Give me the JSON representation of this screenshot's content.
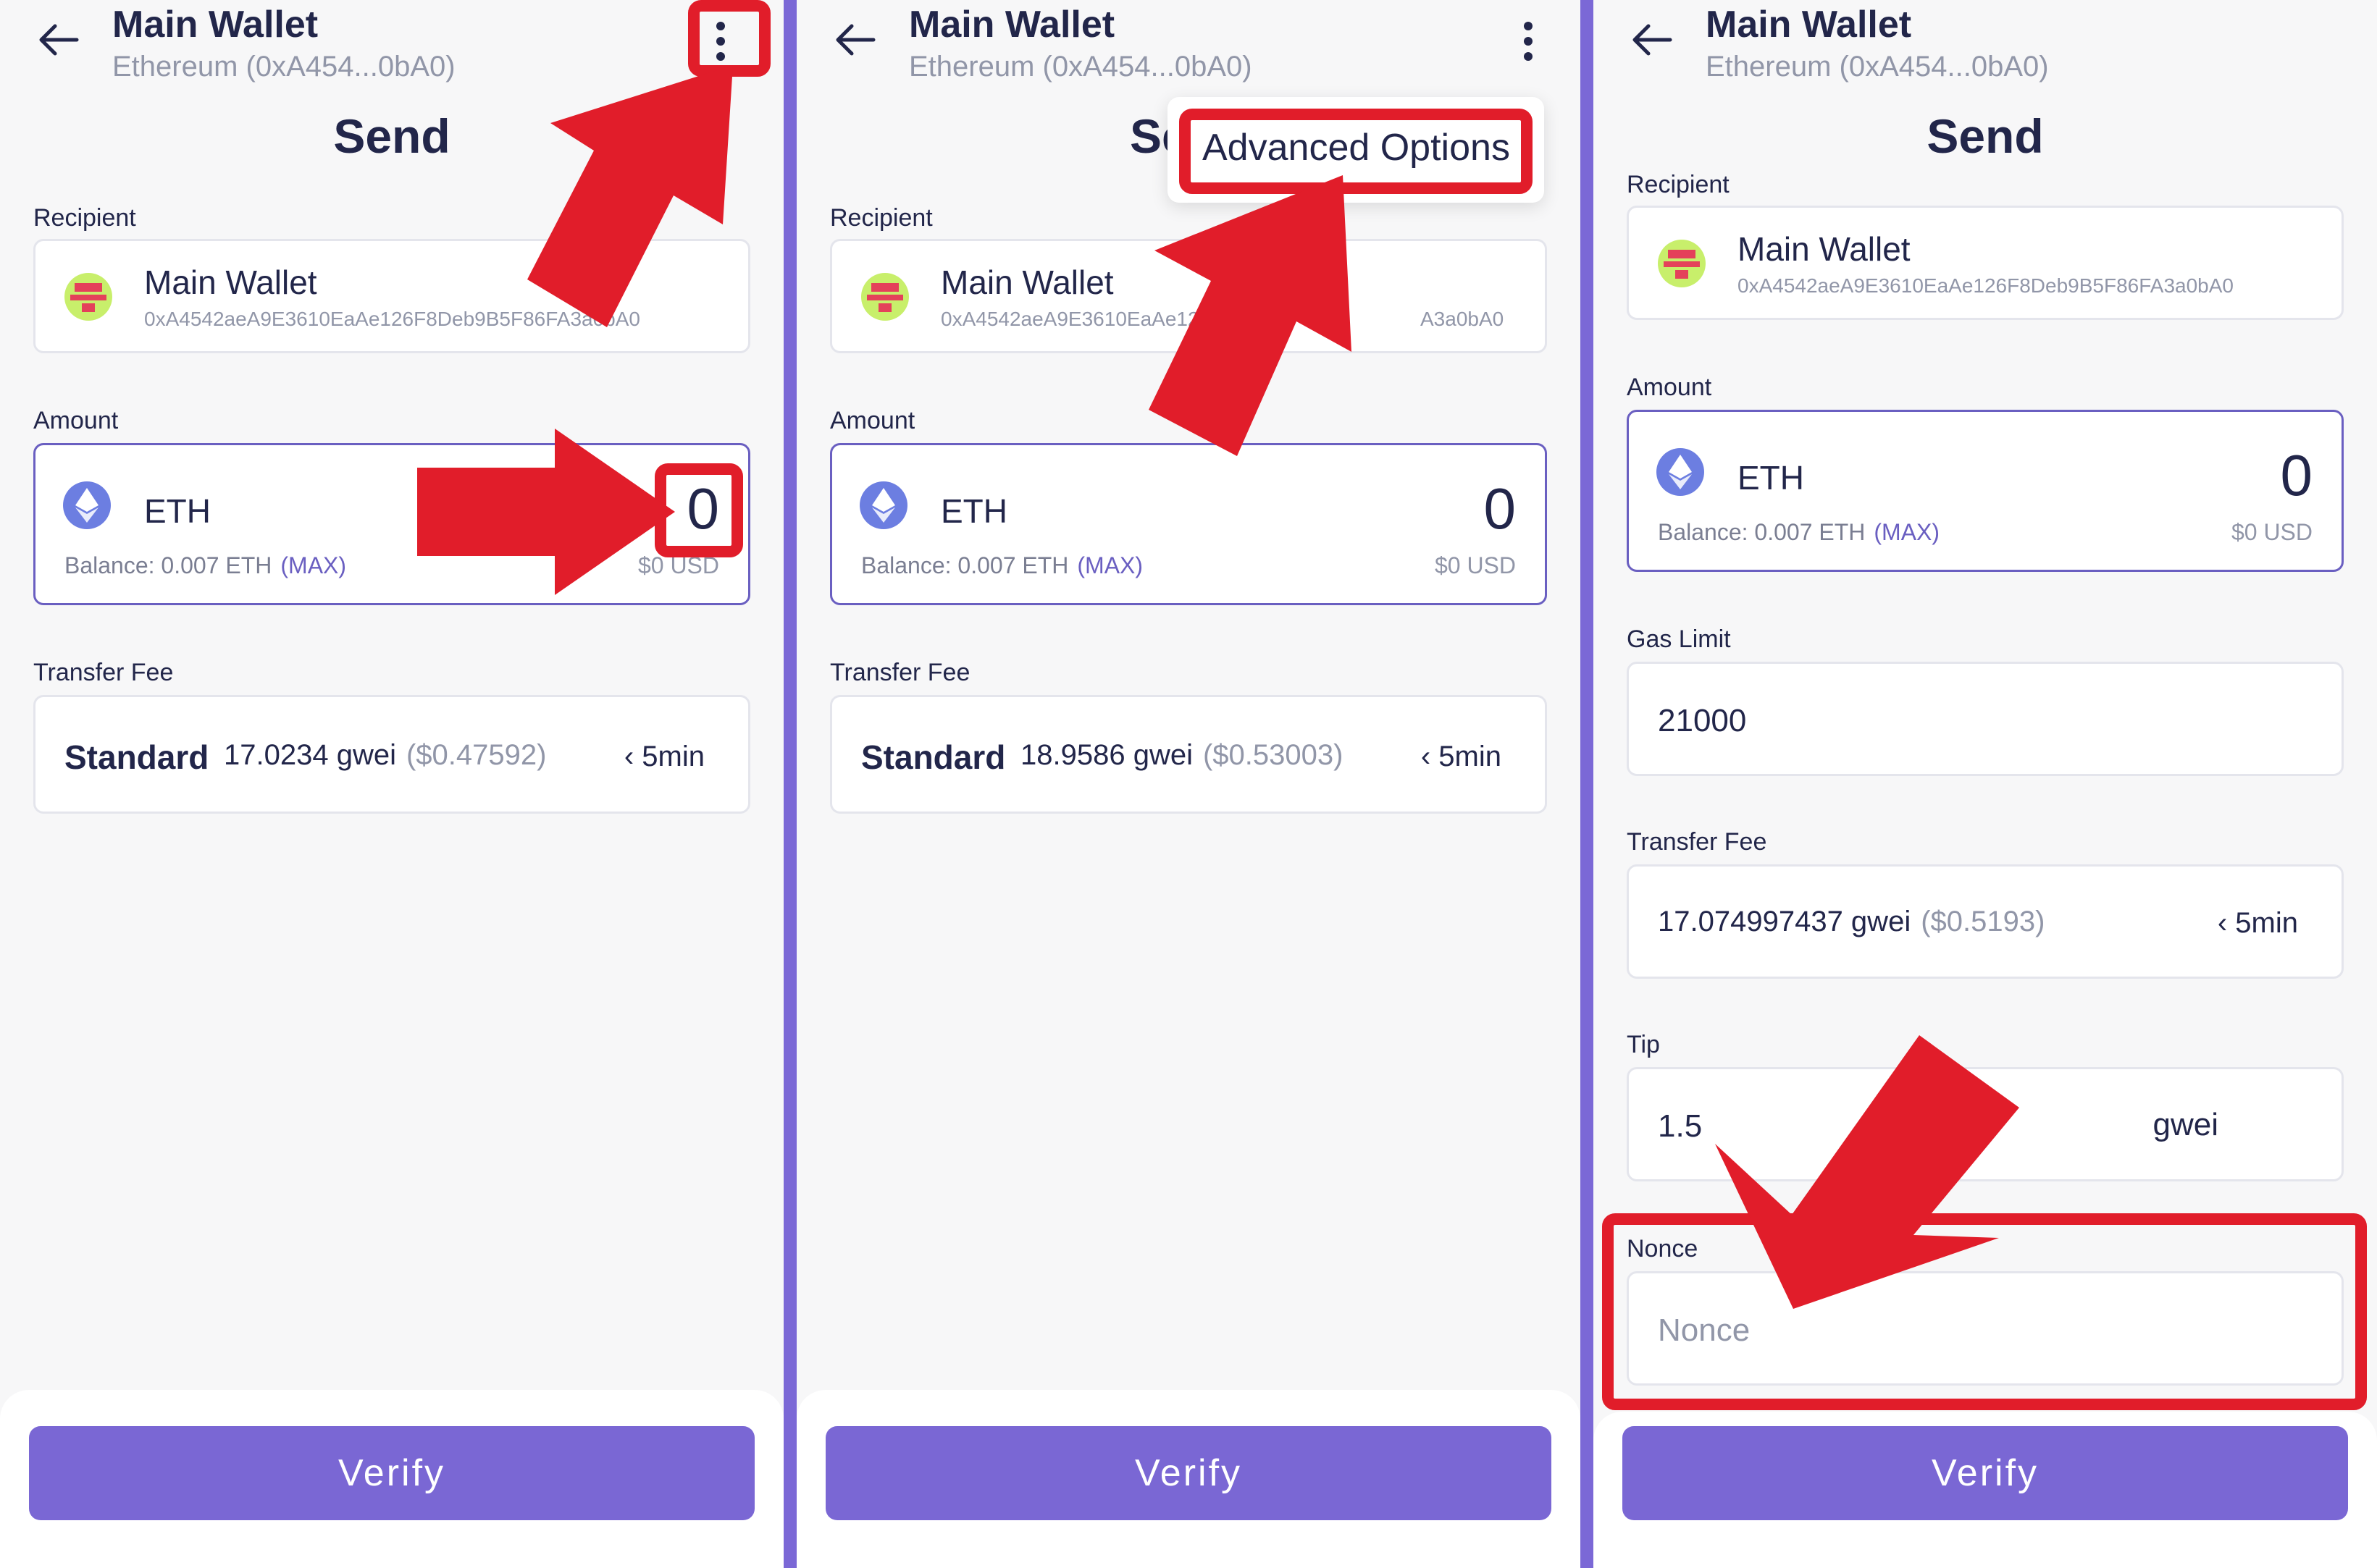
{
  "panels": [
    {
      "wallet_title": "Main Wallet",
      "wallet_sub": "Ethereum (0xA454...0bA0)",
      "page_title": "Send",
      "recipient_label": "Recipient",
      "recipient_name": "Main Wallet",
      "recipient_addr": "0xA4542aeA9E3610EaAe126F8Deb9B5F86FA3a0bA0",
      "amount_label": "Amount",
      "token": "ETH",
      "amount": "0",
      "balance_label": "Balance:",
      "balance_value": "0.007 ETH",
      "max": "(MAX)",
      "usd": "$0 USD",
      "fee_label": "Transfer Fee",
      "fee_tier": "Standard",
      "fee_gwei": "17.0234 gwei",
      "fee_usd": "($0.47592)",
      "fee_time": "‹ 5min",
      "verify": "Verify"
    },
    {
      "wallet_title": "Main Wallet",
      "wallet_sub": "Ethereum (0xA454...0bA0)",
      "page_title": "Se",
      "menu_item": "Advanced Options",
      "recipient_label": "Recipient",
      "recipient_name": "Main Wallet",
      "recipient_addr": "0xA4542aeA9E3610EaAe12",
      "recipient_addr_tail": "A3a0bA0",
      "amount_label": "Amount",
      "token": "ETH",
      "amount": "0",
      "balance_label": "Balance:",
      "balance_value": "0.007 ETH",
      "max": "(MAX)",
      "usd": "$0 USD",
      "fee_label": "Transfer Fee",
      "fee_tier": "Standard",
      "fee_gwei": "18.9586 gwei",
      "fee_usd": "($0.53003)",
      "fee_time": "‹ 5min",
      "verify": "Verify"
    },
    {
      "wallet_title": "Main Wallet",
      "wallet_sub": "Ethereum (0xA454...0bA0)",
      "page_title": "Send",
      "recipient_label": "Recipient",
      "recipient_name": "Main Wallet",
      "recipient_addr": "0xA4542aeA9E3610EaAe126F8Deb9B5F86FA3a0bA0",
      "amount_label": "Amount",
      "token": "ETH",
      "amount": "0",
      "balance_label": "Balance:",
      "balance_value": "0.007 ETH",
      "max": "(MAX)",
      "usd": "$0 USD",
      "gas_limit_label": "Gas Limit",
      "gas_limit_value": "21000",
      "fee_label": "Transfer Fee",
      "fee_gwei": "17.074997437 gwei",
      "fee_usd": "($0.5193)",
      "fee_time": "‹ 5min",
      "tip_label": "Tip",
      "tip_value": "1.5",
      "tip_unit": "gwei",
      "nonce_label": "Nonce",
      "nonce_placeholder": "Nonce",
      "verify": "Verify"
    }
  ],
  "colors": {
    "accent": "#7a67d4",
    "highlight": "#e11d2a",
    "divider": "#7b68d6"
  },
  "icons": [
    "back-arrow-icon",
    "more-vertical-icon",
    "ethereum-icon",
    "identicon-avatar"
  ]
}
